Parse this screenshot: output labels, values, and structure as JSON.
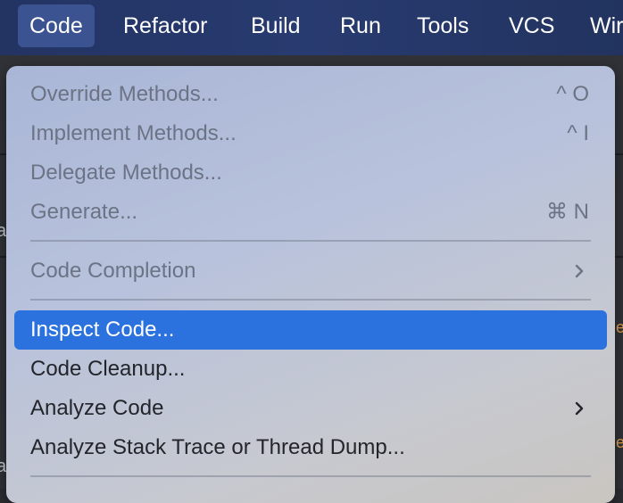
{
  "menubar": {
    "items": [
      {
        "label": "Code",
        "active": true
      },
      {
        "label": "Refactor"
      },
      {
        "label": "Build"
      },
      {
        "label": "Run"
      },
      {
        "label": "Tools"
      },
      {
        "label": "VCS"
      },
      {
        "label": "Wir"
      }
    ]
  },
  "menu": {
    "items": [
      {
        "label": "Override Methods...",
        "shortcut": "^ O",
        "enabled": false
      },
      {
        "label": "Implement Methods...",
        "shortcut": "^ I",
        "enabled": false
      },
      {
        "label": "Delegate Methods...",
        "enabled": false
      },
      {
        "label": "Generate...",
        "shortcut": "⌘ N",
        "enabled": false
      },
      {
        "label": "Code Completion",
        "submenu": true,
        "enabled": false
      },
      {
        "label": "Inspect Code...",
        "enabled": true,
        "selected": true
      },
      {
        "label": "Code Cleanup...",
        "enabled": true
      },
      {
        "label": "Analyze Code",
        "submenu": true,
        "enabled": true
      },
      {
        "label": "Analyze Stack Trace or Thread Dump...",
        "enabled": true
      }
    ]
  },
  "colors": {
    "menubar_bg": "#263a6b",
    "selection": "#2b72de",
    "disabled_text": "#6b7385",
    "enabled_text": "#23252b"
  }
}
